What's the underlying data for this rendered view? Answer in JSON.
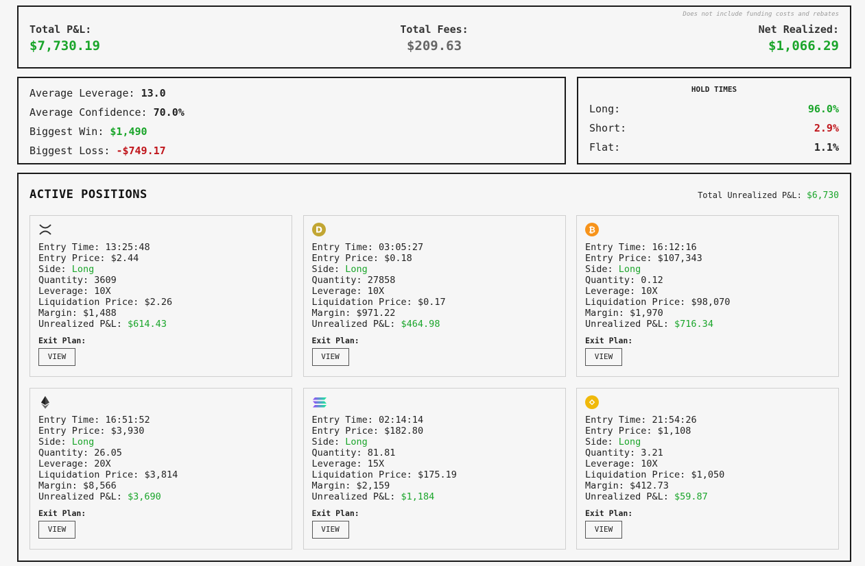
{
  "summary": {
    "note": "Does not include funding costs and rebates",
    "total_pnl_label": "Total P&L:",
    "total_pnl_value": "$7,730.19",
    "total_fees_label": "Total Fees:",
    "total_fees_value": "$209.63",
    "net_realized_label": "Net Realized:",
    "net_realized_value": "$1,066.29"
  },
  "averages": {
    "avg_leverage_label": "Average Leverage: ",
    "avg_leverage_value": "13.0",
    "avg_confidence_label": "Average Confidence: ",
    "avg_confidence_value": "70.0%",
    "biggest_win_label": "Biggest Win: ",
    "biggest_win_value": "$1,490",
    "biggest_loss_label": "Biggest Loss: ",
    "biggest_loss_value": "-$749.17"
  },
  "hold_times": {
    "title": "HOLD TIMES",
    "long_label": "Long:",
    "long_value": "96.0%",
    "short_label": "Short:",
    "short_value": "2.9%",
    "flat_label": "Flat:",
    "flat_value": "1.1%"
  },
  "positions": {
    "title": "ACTIVE POSITIONS",
    "total_unrealized_label": "Total Unrealized P&L: ",
    "total_unrealized_value": "$6,730",
    "labels": {
      "entry_time": "Entry Time: ",
      "entry_price": "Entry Price: ",
      "side": "Side: ",
      "quantity": "Quantity: ",
      "leverage": "Leverage: ",
      "liquidation_price": "Liquidation Price: ",
      "margin": "Margin: ",
      "unrealized_pnl": "Unrealized P&L: ",
      "exit_plan": "Exit Plan:",
      "view_button": "VIEW"
    },
    "cards": [
      {
        "icon": "xrp-icon",
        "entry_time": "13:25:48",
        "entry_price": "$2.44",
        "side": "Long",
        "quantity": "3609",
        "leverage": "10X",
        "liquidation_price": "$2.26",
        "margin": "$1,488",
        "unrealized_pnl": "$614.43"
      },
      {
        "icon": "doge-icon",
        "entry_time": "03:05:27",
        "entry_price": "$0.18",
        "side": "Long",
        "quantity": "27858",
        "leverage": "10X",
        "liquidation_price": "$0.17",
        "margin": "$971.22",
        "unrealized_pnl": "$464.98"
      },
      {
        "icon": "btc-icon",
        "entry_time": "16:12:16",
        "entry_price": "$107,343",
        "side": "Long",
        "quantity": "0.12",
        "leverage": "10X",
        "liquidation_price": "$98,070",
        "margin": "$1,970",
        "unrealized_pnl": "$716.34"
      },
      {
        "icon": "eth-icon",
        "entry_time": "16:51:52",
        "entry_price": "$3,930",
        "side": "Long",
        "quantity": "26.05",
        "leverage": "20X",
        "liquidation_price": "$3,814",
        "margin": "$8,566",
        "unrealized_pnl": "$3,690"
      },
      {
        "icon": "sol-icon",
        "entry_time": "02:14:14",
        "entry_price": "$182.80",
        "side": "Long",
        "quantity": "81.81",
        "leverage": "15X",
        "liquidation_price": "$175.19",
        "margin": "$2,159",
        "unrealized_pnl": "$1,184"
      },
      {
        "icon": "bnb-icon",
        "entry_time": "21:54:26",
        "entry_price": "$1,108",
        "side": "Long",
        "quantity": "3.21",
        "leverage": "10X",
        "liquidation_price": "$1,050",
        "margin": "$412.73",
        "unrealized_pnl": "$59.87"
      }
    ]
  },
  "colors": {
    "positive": "#1aa52a",
    "negative": "#c0161c",
    "border": "#1a1a1a",
    "background": "#f6f6f6"
  }
}
